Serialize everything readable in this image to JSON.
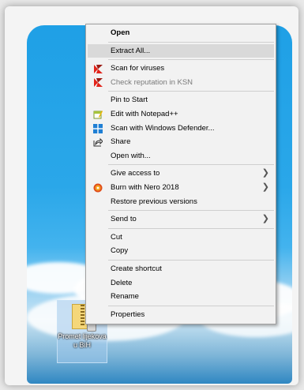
{
  "desktop": {
    "file_label": "Promet lijekova u BiH"
  },
  "menu": {
    "items": [
      {
        "label": "Open"
      },
      {
        "label": "Extract All..."
      },
      {
        "label": "Scan for viruses"
      },
      {
        "label": "Check reputation in KSN"
      },
      {
        "label": "Pin to Start"
      },
      {
        "label": "Edit with Notepad++"
      },
      {
        "label": "Scan with Windows Defender..."
      },
      {
        "label": "Share"
      },
      {
        "label": "Open with..."
      },
      {
        "label": "Give access to"
      },
      {
        "label": "Burn with Nero 2018"
      },
      {
        "label": "Restore previous versions"
      },
      {
        "label": "Send to"
      },
      {
        "label": "Cut"
      },
      {
        "label": "Copy"
      },
      {
        "label": "Create shortcut"
      },
      {
        "label": "Delete"
      },
      {
        "label": "Rename"
      },
      {
        "label": "Properties"
      }
    ]
  },
  "icons": {
    "kaspersky": "kaspersky-icon",
    "notepad": "notepad-plus-plus-icon",
    "defender": "windows-defender-icon",
    "share": "share-icon",
    "nero": "nero-burn-icon",
    "submenu": "chevron-right-icon"
  },
  "colors": {
    "menu_bg": "#f2f2f2",
    "hover_bg": "#d9d9d9",
    "kaspersky_red": "#e2231a",
    "defender_blue": "#1f7fd4"
  }
}
